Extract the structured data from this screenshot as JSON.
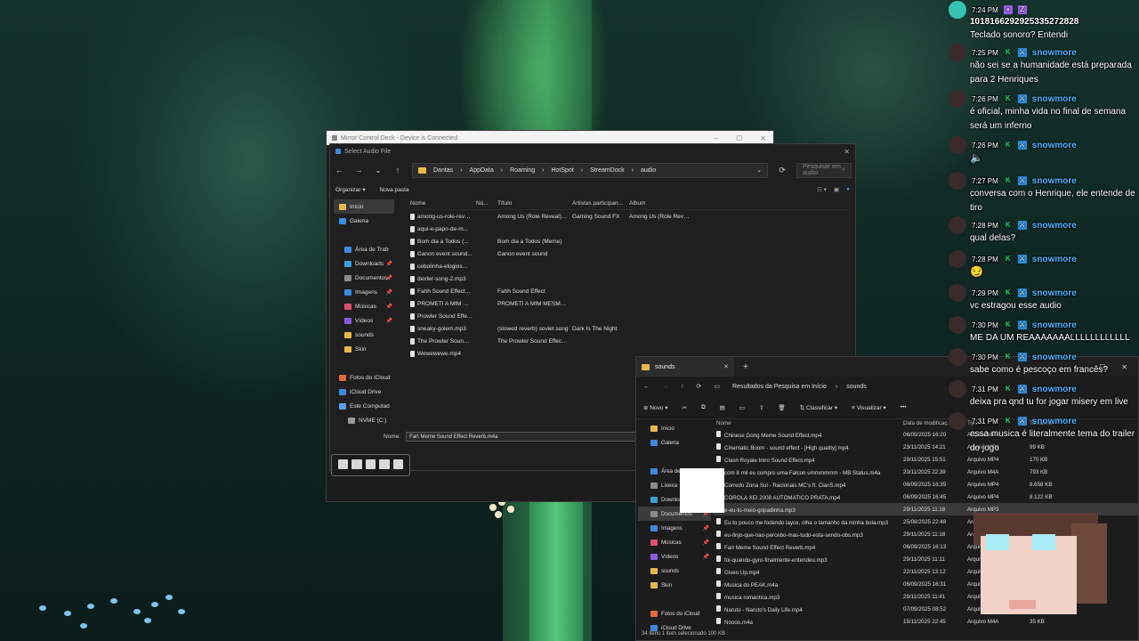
{
  "deck": {
    "title": "Mirror Control Deck - Device is Connected"
  },
  "dialog": {
    "title": "Select Audio File",
    "path": [
      "Dantas",
      "AppData",
      "Roaming",
      "HotSpot",
      "StreamDock",
      "audio"
    ],
    "search_placeholder": "Pesquisar em audio",
    "organize": "Organizar",
    "new_folder": "Nova pasta",
    "nav": [
      {
        "label": "Início",
        "color": "#e8b84a",
        "sel": true
      },
      {
        "label": "Galeria",
        "color": "#3d8be0"
      },
      {
        "label": "Área de Trab",
        "color": "#3d8be0"
      },
      {
        "label": "Downloads",
        "color": "#3aa0d8"
      },
      {
        "label": "Documentos",
        "color": "#8a8a8a"
      },
      {
        "label": "Imagens",
        "color": "#3d8be0"
      },
      {
        "label": "Músicas",
        "color": "#e0506a"
      },
      {
        "label": "Vídeos",
        "color": "#8a5be0"
      },
      {
        "label": "sounds",
        "color": "#e8b84a"
      },
      {
        "label": "Skin",
        "color": "#e8b84a"
      },
      {
        "label": "Fotos do iCloud",
        "color": "#e06a3a"
      },
      {
        "label": "iCloud Drive",
        "color": "#3d8be0"
      },
      {
        "label": "Este Computad",
        "color": "#5aa0e0"
      },
      {
        "label": "NVME (C:)",
        "color": "#999"
      }
    ],
    "columns": [
      "Nome",
      "Nú...",
      "Título",
      "Artistas participan...",
      "Álbum"
    ],
    "files": [
      {
        "name": "among-us-role-reve...",
        "num": "",
        "title": "Among Us (Role Reveal) -...",
        "artist": "Gaming Sound FX",
        "album": "Among Us (Role Reve..."
      },
      {
        "name": "aqui-e-papo-de-m...",
        "num": "",
        "title": "",
        "artist": "",
        "album": ""
      },
      {
        "name": "Bom dia a Todos (...",
        "num": "",
        "title": "Bom dia a Todos (Meme)",
        "artist": "",
        "album": ""
      },
      {
        "name": "Canon event sound...",
        "num": "",
        "title": "Canon event sound",
        "artist": "",
        "album": ""
      },
      {
        "name": "cebolinha-elogios...",
        "num": "",
        "title": "",
        "artist": "",
        "album": ""
      },
      {
        "name": "dexter-song-2.mp3",
        "num": "",
        "title": "",
        "artist": "",
        "album": ""
      },
      {
        "name": "Fahh Sound Effect...",
        "num": "",
        "title": "Fahh Sound Effect",
        "artist": "",
        "album": ""
      },
      {
        "name": "PROMETI A MIM M...",
        "num": "",
        "title": "PROMETI A MIM MESMO...",
        "artist": "",
        "album": ""
      },
      {
        "name": "Prowler Sound Effe...",
        "num": "",
        "title": "",
        "artist": "",
        "album": ""
      },
      {
        "name": "sneaky-golem.mp3",
        "num": "",
        "title": "(slowed reverb) soviet song",
        "artist": "Dark Is The Night",
        "album": ""
      },
      {
        "name": "The Prowler Sound ...",
        "num": "",
        "title": "The Prowler Sound Effect ...",
        "artist": "",
        "album": ""
      },
      {
        "name": "Wewewewe.mp4",
        "num": "",
        "title": "",
        "artist": "",
        "album": ""
      }
    ],
    "name_label": "Nome:",
    "name_value": "Fart Meme Sound Effect Reverb.m4a"
  },
  "explorer": {
    "tab": "sounds",
    "path": [
      "Resultados da Pesquisa em Início",
      "sounds"
    ],
    "search_placeholder": "Pesquisar em sounds",
    "toolbar": {
      "new": "Novo",
      "sort": "Classificar",
      "view": "Visualizar",
      "more": "•••",
      "details": "Detalhes"
    },
    "nav": [
      {
        "label": "Início",
        "color": "#e8b84a"
      },
      {
        "label": "Galeria",
        "color": "#3d8be0"
      },
      {
        "label": "Área de Trab",
        "color": "#3d8be0"
      },
      {
        "label": "Lixeira",
        "color": "#8a8a8a"
      },
      {
        "label": "Downloads",
        "color": "#3aa0d8"
      },
      {
        "label": "Documentos",
        "color": "#8a8a8a",
        "sel": true
      },
      {
        "label": "Imagens",
        "color": "#3d8be0"
      },
      {
        "label": "Músicas",
        "color": "#e0506a"
      },
      {
        "label": "Vídeos",
        "color": "#8a5be0"
      },
      {
        "label": "sounds",
        "color": "#e8b84a"
      },
      {
        "label": "Skin",
        "color": "#e8b84a"
      },
      {
        "label": "Fotos do iCloud",
        "color": "#e06a3a"
      },
      {
        "label": "iCloud Drive",
        "color": "#3d8be0"
      }
    ],
    "columns": [
      "Nome",
      "Data de modificaç...",
      "Tipo",
      "Tamanho"
    ],
    "files": [
      {
        "name": "Chinese Gong Meme Sound Effect.mp4",
        "date": "06/09/2025 16:20",
        "type": "Arquivo MP4",
        "size": "..."
      },
      {
        "name": "Cinematic Boom - sound effect - [High quality].mp4",
        "date": "23/11/2025 14:21",
        "type": "Arquivo MP4",
        "size": "99 KB"
      },
      {
        "name": "Clash Royale Intro Sound Effect.mp4",
        "date": "29/11/2025 15:51",
        "type": "Arquivo MP4",
        "size": "170 KB"
      },
      {
        "name": "com 8 mil eu compro uma Falcon ummmmmm - MB Status.m4a",
        "date": "20/11/2025 22:39",
        "type": "Arquivo M4A",
        "size": "793 KB"
      },
      {
        "name": "Corredo Zona Sul - Racionais MC's ft. ClanS.mp4",
        "date": "06/09/2025 16:35",
        "type": "Arquivo MP4",
        "size": "8.658 KB"
      },
      {
        "name": "COROLA XEI 2008 AUTOMATICO PRATA.mp4",
        "date": "06/09/2025 16:45",
        "type": "Arquivo MP4",
        "size": "8.122 KB"
      },
      {
        "name": "e-eu-to-meio-gripadinha.mp3",
        "date": "29/11/2025 11:18",
        "type": "Arquivo MP3",
        "size": "",
        "sel": true
      },
      {
        "name": "Eu to pouco me fodendo layce, olha o tamanho da minha bola.mp3",
        "date": "25/08/2025 22:48",
        "type": "Arquivo MP3",
        "size": ""
      },
      {
        "name": "eu-finjo-que-nao-percebo-mas-tudo-esta-sendo-obs.mp3",
        "date": "29/11/2025 11:18",
        "type": "Arquivo MP3",
        "size": ""
      },
      {
        "name": "Fart Meme Sound Effect Reverb.mp4",
        "date": "06/09/2025 16:13",
        "type": "Arquivo MP4",
        "size": ""
      },
      {
        "name": "foi-quando-gyro-finalmente-entendeu.mp3",
        "date": "29/11/2025 11:11",
        "type": "Arquivo MP3",
        "size": ""
      },
      {
        "name": "Given Up.mp4",
        "date": "22/11/2025 13:12",
        "type": "Arquivo MP4",
        "size": ""
      },
      {
        "name": "Musica do PEAK.m4a",
        "date": "06/09/2025 16:31",
        "type": "Arquivo M4A",
        "size": ""
      },
      {
        "name": "musica romantica.mp3",
        "date": "29/11/2025 11:41",
        "type": "Arquivo MP3",
        "size": ""
      },
      {
        "name": "Naruto - Naruto's Daily Life.mp4",
        "date": "07/09/2025 08:52",
        "type": "Arquivo MP4",
        "size": ""
      },
      {
        "name": "Noooo.m4a",
        "date": "15/11/2025 22:45",
        "type": "Arquivo M4A",
        "size": "35 KB"
      }
    ],
    "status": "34 itens   1 item selecionado  100 KB"
  },
  "chat": [
    {
      "time": "7:24 PM",
      "user": "1018166292925335272828",
      "text": "Teclado sonoro? Entendi",
      "teal": true,
      "white": true
    },
    {
      "time": "7:25 PM",
      "user": "snowmore",
      "text": "não sei se a humanidade está preparada para 2 Henriques"
    },
    {
      "time": "7:26 PM",
      "user": "snowmore",
      "text": "é oficial, minha vida no final de semana será um inferno"
    },
    {
      "time": "7:26 PM",
      "user": "snowmore",
      "text": "",
      "emote": "🔈"
    },
    {
      "time": "7:27 PM",
      "user": "snowmore",
      "text": "conversa com o Henrique, ele entende de tiro"
    },
    {
      "time": "7:28 PM",
      "user": "snowmore",
      "text": "qual delas?"
    },
    {
      "time": "7:28 PM",
      "user": "snowmore",
      "text": "",
      "emote": "😏"
    },
    {
      "time": "7:29 PM",
      "user": "snowmore",
      "text": "vc estragou esse audio"
    },
    {
      "time": "7:30 PM",
      "user": "snowmore",
      "text": "ME DA UM REAAAAAAALLLLLLLLLLLL"
    },
    {
      "time": "7:30 PM",
      "user": "snowmore",
      "text": "sabe como é pescoço em francês?"
    },
    {
      "time": "7:31 PM",
      "user": "snowmore",
      "text": "deixa pra qnd tu for jogar misery em live"
    },
    {
      "time": "7:31 PM",
      "user": "snowmore",
      "text": "essa musica é literalmente tema do trailer do jogo"
    }
  ]
}
